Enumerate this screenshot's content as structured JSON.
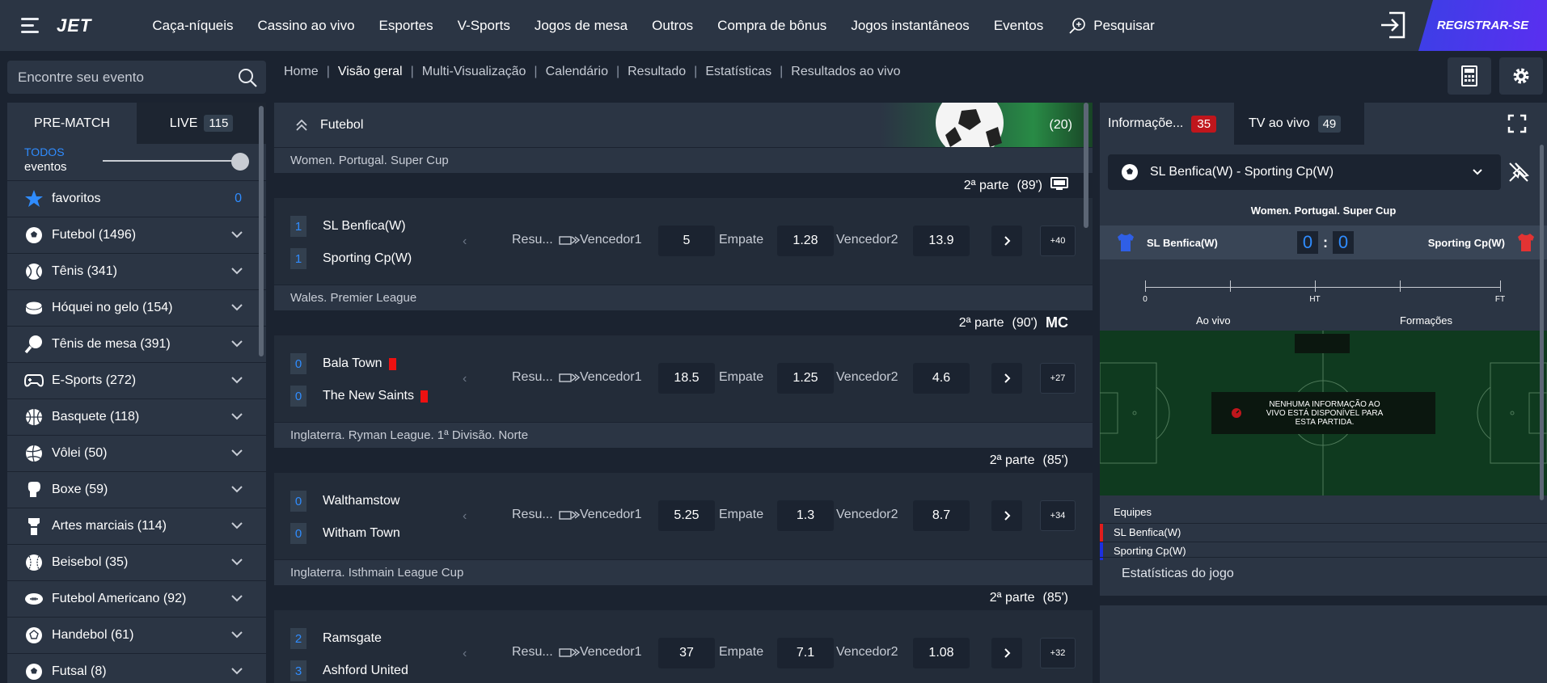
{
  "brand": "JET",
  "nav": [
    "Caça-níqueis",
    "Cassino ao vivo",
    "Esportes",
    "V-Sports",
    "Jogos de mesa",
    "Outros",
    "Compra de bônus",
    "Jogos instantâneos",
    "Eventos"
  ],
  "nav_search": "Pesquisar",
  "register": "REGISTRAR-SE",
  "search": {
    "placeholder": "Encontre seu evento"
  },
  "breadcrumbs": [
    "Home",
    "Visão geral",
    "Multi-Visualização",
    "Calendário",
    "Resultado",
    "Estatísticas",
    "Resultados ao vivo"
  ],
  "left": {
    "tab_prematch": "PRE-MATCH",
    "tab_live": "LIVE",
    "live_count": "115",
    "todos": "TODOS",
    "eventos": "eventos",
    "favorites_label": "favoritos",
    "favorites_count": "0",
    "sports": [
      {
        "label": "Futebol (1496)",
        "icon": "soccer-ball-icon"
      },
      {
        "label": "Tênis (341)",
        "icon": "tennis-ball-icon"
      },
      {
        "label": "Hóquei no gelo (154)",
        "icon": "hockey-puck-icon"
      },
      {
        "label": "Tênis de mesa (391)",
        "icon": "ping-pong-icon"
      },
      {
        "label": "E-Sports (272)",
        "icon": "gamepad-icon"
      },
      {
        "label": "Basquete (118)",
        "icon": "basketball-icon"
      },
      {
        "label": "Vôlei (50)",
        "icon": "volleyball-icon"
      },
      {
        "label": "Boxe (59)",
        "icon": "boxing-glove-icon"
      },
      {
        "label": "Artes marciais (114)",
        "icon": "martial-arts-icon"
      },
      {
        "label": "Beisebol (35)",
        "icon": "baseball-icon"
      },
      {
        "label": "Futebol Americano (92)",
        "icon": "american-football-icon"
      },
      {
        "label": "Handebol (61)",
        "icon": "handball-icon"
      },
      {
        "label": "Futsal (8)",
        "icon": "futsal-icon"
      }
    ]
  },
  "center": {
    "sport_title": "Futebol",
    "sport_count": "(20)",
    "market_short": "Resu...",
    "market_w1": "Vencedor1",
    "market_x": "Empate",
    "market_w2": "Vencedor2",
    "matches": [
      {
        "league": "Women. Portugal. Super Cup",
        "period": "2ª parte",
        "time": "(89')",
        "extra_icon": "tv-icon",
        "home": "SL Benfica(W)",
        "away": "Sporting Cp(W)",
        "home_score": "1",
        "away_score": "1",
        "odd1": "5",
        "oddx": "1.28",
        "odd2": "13.9",
        "more": "+40"
      },
      {
        "league": "Wales. Premier League",
        "period": "2ª parte",
        "time": "(90')",
        "extra_icon": "MC",
        "home": "Bala Town",
        "away": "The New Saints",
        "home_score": "0",
        "away_score": "0",
        "odd1": "18.5",
        "oddx": "1.25",
        "odd2": "4.6",
        "more": "+27"
      },
      {
        "league": "Inglaterra. Ryman League. 1ª Divisão. Norte",
        "period": "2ª parte",
        "time": "(85')",
        "extra_icon": "",
        "home": "Walthamstow",
        "away": "Witham Town",
        "home_score": "0",
        "away_score": "0",
        "odd1": "5.25",
        "oddx": "1.3",
        "odd2": "8.7",
        "more": "+34"
      },
      {
        "league": "Inglaterra. Isthmain League Cup",
        "period": "2ª parte",
        "time": "(85')",
        "extra_icon": "",
        "home": "Ramsgate",
        "away": "Ashford United",
        "home_score": "2",
        "away_score": "3",
        "odd1": "37",
        "oddx": "7.1",
        "odd2": "1.08",
        "more": "+32"
      }
    ]
  },
  "right": {
    "tab_info": "Informaçõe...",
    "info_count": "35",
    "tab_tv": "TV ao vivo",
    "tv_count": "49",
    "selected_match": "SL Benfica(W) - Sporting Cp(W)",
    "competition": "Women. Portugal. Super Cup",
    "home": "SL Benfica(W)",
    "away": "Sporting Cp(W)",
    "home_score": "0",
    "away_score": "0",
    "score_sep": ":",
    "timeline": {
      "start": "0",
      "mid": "HT",
      "end": "FT"
    },
    "tab_live": "Ao vivo",
    "tab_lineups": "Formações",
    "no_live_info": "NENHUMA INFORMAÇÃO AO VIVO ESTÁ DISPONÍVEL PARA ESTA PARTIDA.",
    "teams_title": "Equipes",
    "team1": "SL Benfica(W)",
    "team2": "Sporting Cp(W)",
    "stats_title": "Estatísticas do jogo"
  },
  "colors": {
    "accent_blue": "#2f8cff",
    "red_badge": "#c0161c",
    "register_gradient": "#4433ee",
    "home_color": "#e11d1d",
    "away_color": "#1d2fe1"
  }
}
